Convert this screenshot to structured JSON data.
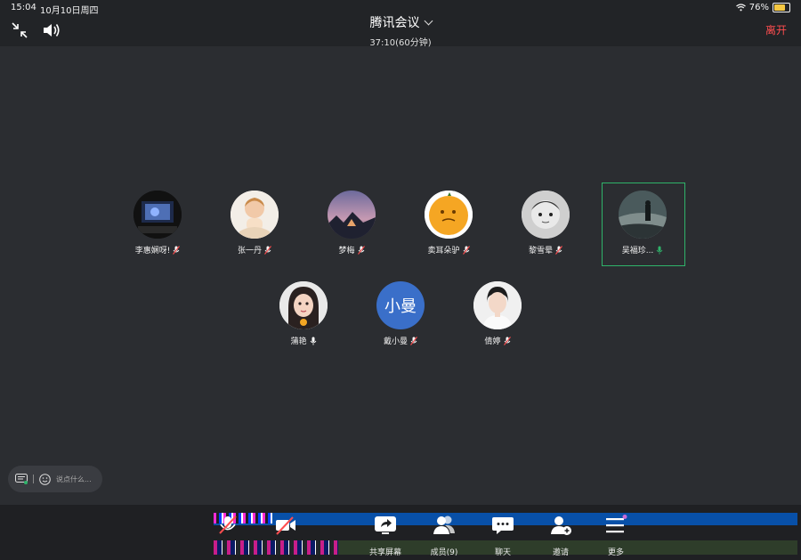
{
  "status": {
    "time": "15:04",
    "date": "10月10日周四",
    "battery": "76%",
    "battery_level": 0.76
  },
  "header": {
    "title": "腾讯会议",
    "subtitle": "37:10(60分钟)",
    "leave": "离开"
  },
  "participants": [
    {
      "name": "李惠娴呀!",
      "mic": "muted"
    },
    {
      "name": "张一丹",
      "mic": "muted"
    },
    {
      "name": "梦梅",
      "mic": "muted"
    },
    {
      "name": "卖耳朵驴",
      "mic": "muted"
    },
    {
      "name": "黎雪晕",
      "mic": "muted"
    },
    {
      "name": "吴福珍...",
      "mic": "active"
    },
    {
      "name": "蒲艳",
      "mic": "on"
    },
    {
      "name": "戴小曼",
      "mic": "muted",
      "avatar_text": "小曼"
    },
    {
      "name": "倩婷",
      "mic": "muted"
    }
  ],
  "chat": {
    "placeholder": "说点什么..."
  },
  "toolbar": {
    "items": [
      {
        "label": "共享屏幕",
        "icon": "share-screen-icon"
      },
      {
        "label": "成员(9)",
        "icon": "members-icon"
      },
      {
        "label": "聊天",
        "icon": "chat-icon"
      },
      {
        "label": "邀请",
        "icon": "invite-icon"
      },
      {
        "label": "更多",
        "icon": "more-icon"
      }
    ]
  },
  "colors": {
    "accent_green": "#2fb36a",
    "leave_red": "#ff4d4f",
    "battery_yellow": "#f5c842"
  }
}
